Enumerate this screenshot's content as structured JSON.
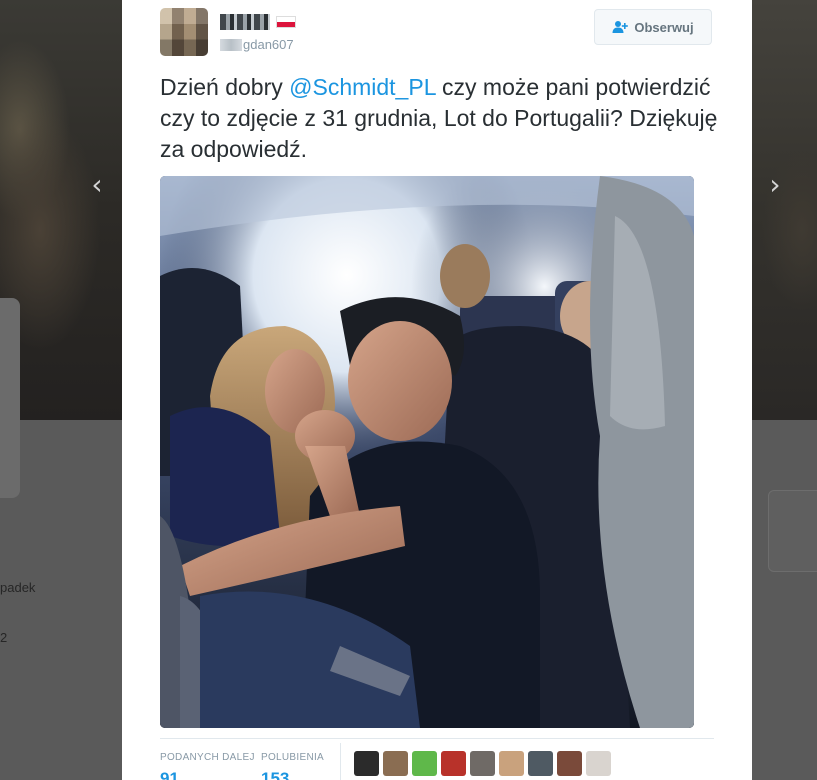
{
  "background": {
    "left_text_1": "padek",
    "left_text_2": "2",
    "prev_arrow": "chevron-left-icon",
    "next_arrow": "chevron-right-icon"
  },
  "tweet": {
    "screen_name_visible": "gdan607",
    "follow_button_label": "Obserwuj",
    "follow_icon": "follow-user-icon",
    "text_before": "Dzień dobry ",
    "mention": "@Schmidt_PL",
    "text_after": " czy może pani potwierdzić czy to zdjęcie z 31 grudnia, Lot do Portugalii? Dziękuję za odpowiedź."
  },
  "stats": {
    "retweets_label": "PODANYCH DALEJ",
    "retweets_value": "91",
    "likes_label": "POLUBIENIA",
    "likes_value": "153",
    "liker_colors": [
      "#2b2b2b",
      "#8a6d52",
      "#5fb84a",
      "#b8322a",
      "#6f6a66",
      "#c9a27d",
      "#4f5a63",
      "#7a4a3a",
      "#d9d4cf"
    ]
  },
  "colors": {
    "link": "#1b95e0",
    "text": "#292f33",
    "muted": "#8899a6",
    "flag_red": "#dc143c"
  }
}
